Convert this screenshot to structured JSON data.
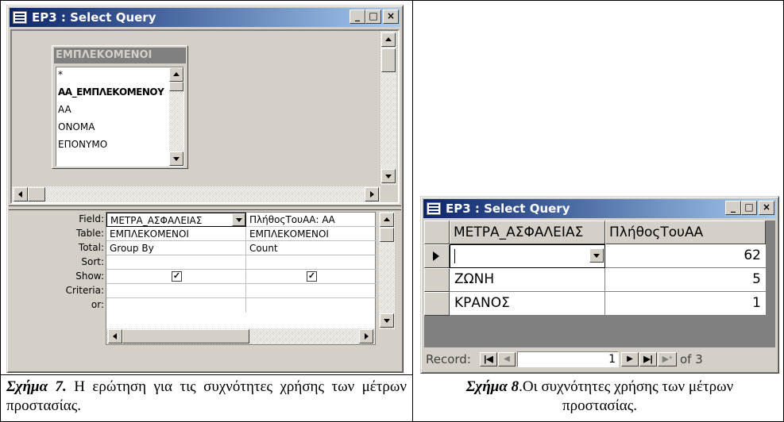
{
  "query_window": {
    "title": "EP3 : Select Query",
    "table_box": {
      "title": "ΕΜΠΛΕΚΟΜΕΝΟΙ",
      "fields": [
        "*",
        "AA_EMΠΛΕΚΟΜΕΝΟΥ",
        "AA",
        "ONOMA",
        "EΠΟΝΥΜΟ"
      ]
    },
    "row_labels": [
      "Field:",
      "Table:",
      "Total:",
      "Sort:",
      "Show:",
      "Criteria:",
      "or:"
    ],
    "columns": [
      {
        "field": "ΜΕΤΡΑ_ΑΣΦΑΛΕΙΑΣ",
        "table": "ΕΜΠΛΕΚΟΜΕΝΟΙ",
        "total": "Group By",
        "sort": "",
        "show": true
      },
      {
        "field": "ΠλήθοςΤουΑΑ: ΑΑ",
        "table": "ΕΜΠΛΕΚΟΜΕΝΟΙ",
        "total": "Count",
        "sort": "",
        "show": true
      }
    ]
  },
  "result_window": {
    "title": "EP3 : Select Query",
    "headers": [
      "ΜΕΤΡΑ_ΑΣΦΑΛΕΙΑΣ",
      "ΠλήθοςΤουΑΑ"
    ],
    "rows": [
      {
        "measure": "",
        "count": "62"
      },
      {
        "measure": "ΖΩΝΗ",
        "count": "5"
      },
      {
        "measure": "ΚΡΑΝΟΣ",
        "count": "1"
      }
    ],
    "nav": {
      "record_label": "Record:",
      "current": "1",
      "of_label": "of 3"
    }
  },
  "captions": {
    "fig7_label": "Σχήμα 7.",
    "fig7_text": " Η ερώτηση για τις συχνότητες χρήσης των μέτρων προστασίας.",
    "fig8_label": "Σχήμα 8",
    "fig8_text": ".Οι συχνότητες χρήσης των μέτρων προστασίας."
  }
}
